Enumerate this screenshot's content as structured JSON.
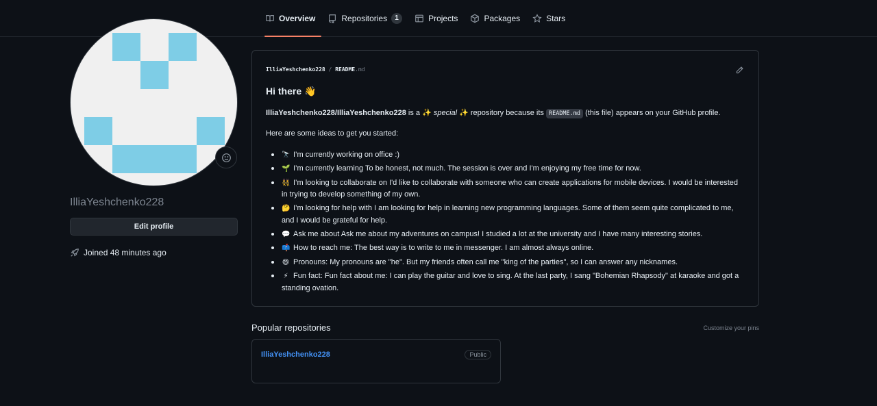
{
  "nav": {
    "tabs": [
      {
        "label": "Overview",
        "icon": "book-icon",
        "selected": true
      },
      {
        "label": "Repositories",
        "icon": "repo-icon",
        "count": "1"
      },
      {
        "label": "Projects",
        "icon": "table-icon"
      },
      {
        "label": "Packages",
        "icon": "package-icon"
      },
      {
        "label": "Stars",
        "icon": "star-icon"
      }
    ]
  },
  "profile": {
    "username": "IlliaYeshchenko228",
    "edit_label": "Edit profile",
    "joined": "Joined 48 minutes ago",
    "avatar_colors": {
      "background": "#f0f0f0",
      "pixel": "#7ecde6"
    }
  },
  "readme": {
    "path_owner": "IlliaYeshchenko228",
    "path_sep": "/",
    "path_file": "README",
    "path_ext": ".md",
    "heading": "Hi there 👋",
    "intro_repo": "IlliaYeshchenko228/IlliaYeshchenko228",
    "intro_is": " is a ✨ ",
    "intro_special": "special",
    "intro_after": " ✨ repository because its ",
    "intro_code": "README.md",
    "intro_end": " (this file) appears on your GitHub profile.",
    "ideas": "Here are some ideas to get you started:",
    "items": [
      {
        "emoji": "🔭",
        "text": "I’m currently working on office :)"
      },
      {
        "emoji": "🌱",
        "text": "I’m currently learning To be honest, not much. The session is over and I'm enjoying my free time for now."
      },
      {
        "emoji": "👯",
        "text": "I’m looking to collaborate on I'd like to collaborate with someone who can create applications for mobile devices. I would be interested in trying to develop something of my own."
      },
      {
        "emoji": "🤔",
        "text": "I’m looking for help with I am looking for help in learning new programming languages. Some of them seem quite complicated to me, and I would be grateful for help."
      },
      {
        "emoji": "💬",
        "text": "Ask me about Ask me about my adventures on campus! I studied a lot at the university and I have many interesting stories."
      },
      {
        "emoji": "📫",
        "text": "How to reach me: The best way is to write to me in messenger. I am almost always online."
      },
      {
        "emoji": "😄",
        "text": "Pronouns: My pronouns are \"he\". But my friends often call me \"king of the parties\", so I can answer any nicknames."
      },
      {
        "emoji": "⚡",
        "text": "Fun fact: Fun fact about me: I can play the guitar and love to sing. At the last party, I sang \"Bohemian Rhapsody\" at karaoke and got a standing ovation."
      }
    ]
  },
  "popular": {
    "title": "Popular repositories",
    "customize": "Customize your pins",
    "repos": [
      {
        "name": "IlliaYeshchenko228",
        "visibility": "Public"
      }
    ]
  }
}
